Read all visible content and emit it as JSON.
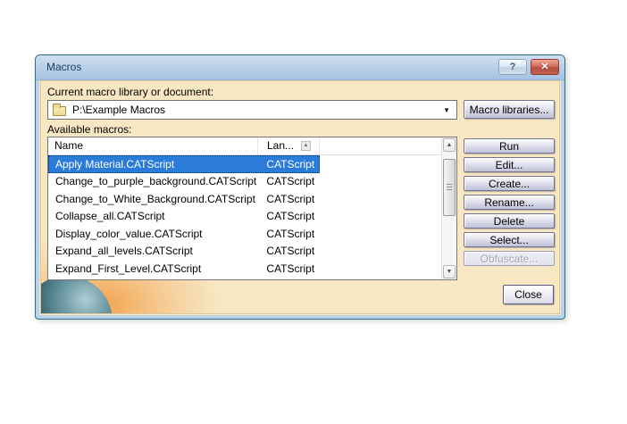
{
  "window": {
    "title": "Macros"
  },
  "library": {
    "label": "Current macro library or document:",
    "value": "P:\\Example Macros",
    "browse_button": "Macro libraries..."
  },
  "macros": {
    "label": "Available macros:",
    "columns": [
      {
        "label": "Name"
      },
      {
        "label": "Lan..."
      }
    ],
    "rows": [
      {
        "name": "Apply Material.CATScript",
        "language": "CATScript",
        "selected": true
      },
      {
        "name": "Change_to_purple_background.CATScript",
        "language": "CATScript",
        "selected": false
      },
      {
        "name": "Change_to_White_Background.CATScript",
        "language": "CATScript",
        "selected": false
      },
      {
        "name": "Collapse_all.CATScript",
        "language": "CATScript",
        "selected": false
      },
      {
        "name": "Display_color_value.CATScript",
        "language": "CATScript",
        "selected": false
      },
      {
        "name": "Expand_all_levels.CATScript",
        "language": "CATScript",
        "selected": false
      },
      {
        "name": "Expand_First_Level.CATScript",
        "language": "CATScript",
        "selected": false
      }
    ]
  },
  "actions": [
    {
      "label": "Run",
      "enabled": true
    },
    {
      "label": "Edit...",
      "enabled": true
    },
    {
      "label": "Create...",
      "enabled": true
    },
    {
      "label": "Rename...",
      "enabled": true
    },
    {
      "label": "Delete",
      "enabled": true
    },
    {
      "label": "Select...",
      "enabled": true
    },
    {
      "label": "Obfuscate...",
      "enabled": false
    }
  ],
  "footer": {
    "close_button": "Close"
  },
  "icons": {
    "help": "?",
    "window_close": "✕",
    "dropdown": "▼",
    "scroll_up": "▲",
    "scroll_down": "▼",
    "sort": "▲"
  },
  "colors": {
    "selection_blue": "#2b7cd8",
    "dialog_beige": "#f7e7c3",
    "frame_blue": "#bad3ec",
    "titlebar_blue": "#bcd2ea",
    "button_lavender": "#cfcfe3",
    "close_button_red": "#c4604d",
    "watermark_orange": "#f2983a",
    "watermark_teal": "#36636f"
  }
}
